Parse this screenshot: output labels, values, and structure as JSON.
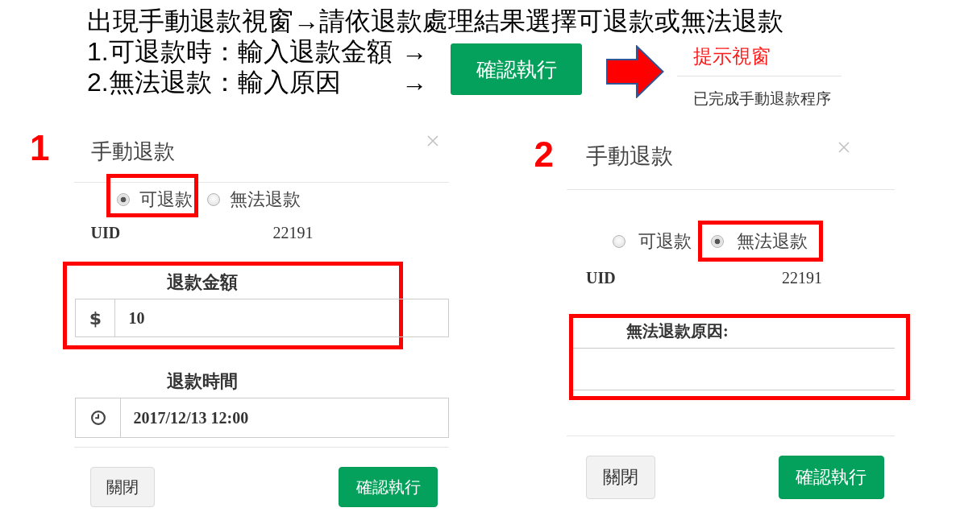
{
  "instructions": {
    "heading": "出現手動退款視窗→請依退款處理結果選擇可退款或無法退款",
    "steps": [
      {
        "text": "1.可退款時：輸入退款金額",
        "arrow": "→"
      },
      {
        "text": "2.無法退款：輸入原因",
        "arrow": "→"
      }
    ],
    "action_button": "確認執行",
    "result_popup": {
      "title": "提示視窗",
      "message": "已完成手動退款程序"
    }
  },
  "dialogs": [
    {
      "step_number": "1",
      "title": "手動退款",
      "options": [
        {
          "label": "可退款",
          "selected": true,
          "highlighted": true
        },
        {
          "label": "無法退款",
          "selected": false,
          "highlighted": false
        }
      ],
      "uid_label": "UID",
      "uid_value": "22191",
      "fields": [
        {
          "kind": "currency",
          "label": "退款金額",
          "addon": "$",
          "value": "10",
          "highlighted": true
        },
        {
          "kind": "datetime",
          "label": "退款時間",
          "value": "2017/12/13 12:00",
          "highlighted": false
        }
      ],
      "buttons": [
        {
          "kind": "default",
          "label": "關閉"
        },
        {
          "kind": "primary",
          "label": "確認執行"
        }
      ]
    },
    {
      "step_number": "2",
      "title": "手動退款",
      "options": [
        {
          "label": "可退款",
          "selected": false,
          "highlighted": false
        },
        {
          "label": "無法退款",
          "selected": true,
          "highlighted": true
        }
      ],
      "uid_label": "UID",
      "uid_value": "22191",
      "fields": [
        {
          "kind": "textarea",
          "label": "無法退款原因:",
          "highlighted": true
        }
      ],
      "buttons": [
        {
          "kind": "default",
          "label": "關閉"
        },
        {
          "kind": "primary",
          "label": "確認執行"
        }
      ]
    }
  ]
}
